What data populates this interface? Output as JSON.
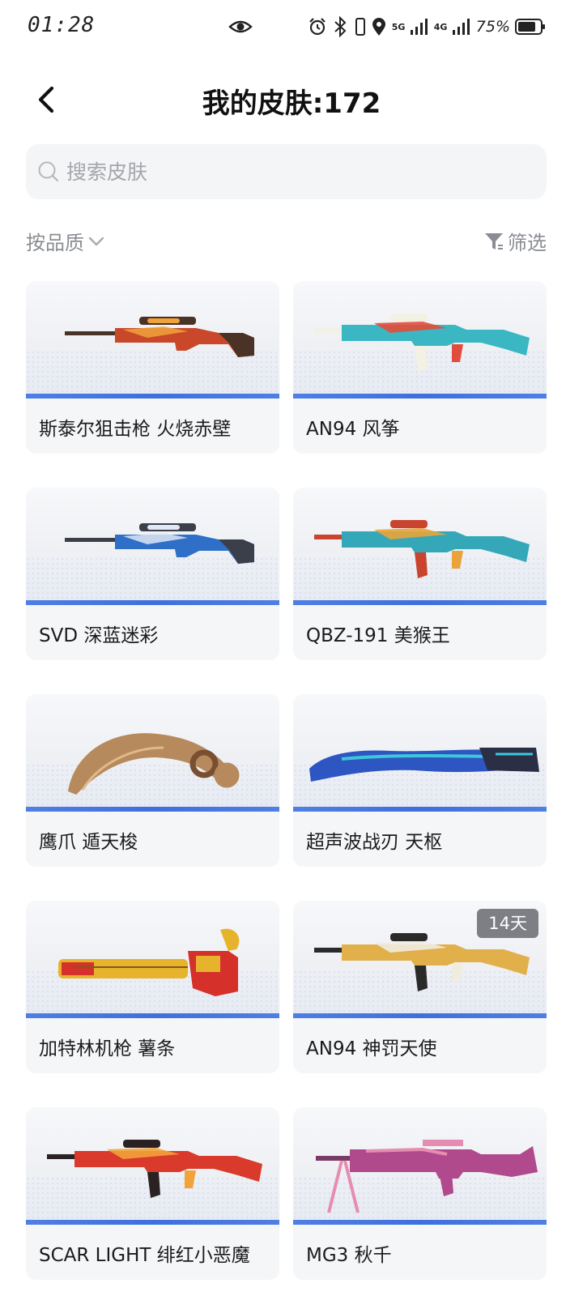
{
  "status_bar": {
    "time": "01:28",
    "network_1": "5G",
    "network_2": "4G",
    "battery": "75%"
  },
  "header": {
    "title": "我的皮肤:172"
  },
  "search": {
    "placeholder": "搜索皮肤"
  },
  "filters": {
    "sort_label": "按品质",
    "filter_label": "筛选"
  },
  "skins": [
    {
      "name": "斯泰尔狙击枪 火烧赤壁",
      "icon": "sniper-rifle-icon",
      "colors": [
        "#c9482a",
        "#f0a33b",
        "#4a3226"
      ]
    },
    {
      "name": "AN94 风筝",
      "icon": "assault-rifle-icon",
      "colors": [
        "#3bb7c4",
        "#e24c3c",
        "#f3f0e4"
      ]
    },
    {
      "name": "SVD 深蓝迷彩",
      "icon": "sniper-rifle-icon",
      "colors": [
        "#2f6fc7",
        "#dfe8f4",
        "#3a3f4a"
      ]
    },
    {
      "name": "QBZ-191 美猴王",
      "icon": "assault-rifle-icon",
      "colors": [
        "#34a8b8",
        "#e8a43a",
        "#c9442e"
      ]
    },
    {
      "name": "鹰爪 遁天梭",
      "icon": "karambit-icon",
      "colors": [
        "#b68a5c",
        "#7a4f31",
        "#e0b98a"
      ]
    },
    {
      "name": "超声波战刃 天枢",
      "icon": "blade-icon",
      "colors": [
        "#2d56c2",
        "#3ec7d9",
        "#2b2f45"
      ]
    },
    {
      "name": "加特林机枪 薯条",
      "icon": "minigun-icon",
      "colors": [
        "#e7b32c",
        "#d5302a",
        "#7a5c1a"
      ]
    },
    {
      "name": "AN94 神罚天使",
      "icon": "assault-rifle-icon",
      "colors": [
        "#e2b04a",
        "#f1ece0",
        "#2a2a2a"
      ],
      "badge": "14天"
    },
    {
      "name": "SCAR LIGHT 绯红小恶魔",
      "icon": "assault-rifle-icon",
      "colors": [
        "#d93a2b",
        "#f2a23a",
        "#2a2222"
      ]
    },
    {
      "name": "MG3 秋千",
      "icon": "machine-gun-icon",
      "colors": [
        "#b04a8c",
        "#e58db0",
        "#7a3a66"
      ]
    }
  ]
}
